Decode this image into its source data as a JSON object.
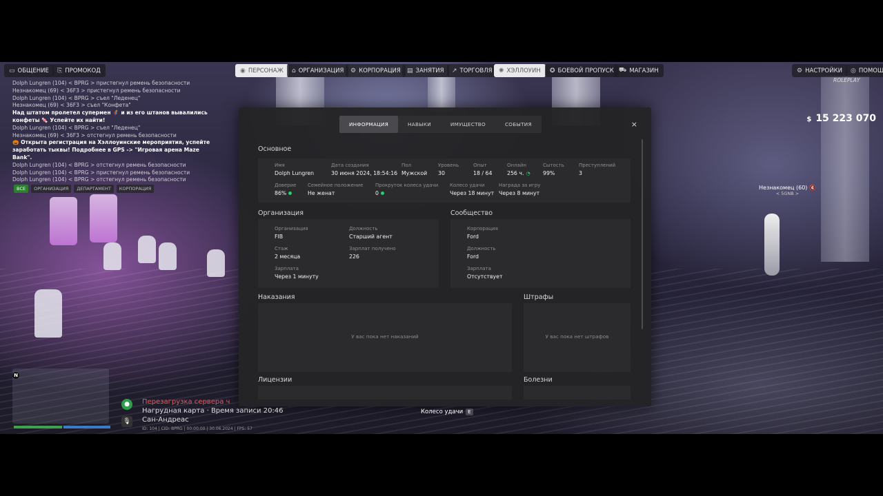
{
  "nav_left": [
    {
      "label": "ОБЩЕНИЕ",
      "icon": "chat-icon"
    },
    {
      "label": "ПРОМОКОД",
      "icon": "ticket-icon"
    }
  ],
  "nav_center": [
    {
      "label": "ПЕРСОНАЖ",
      "icon": "user-icon",
      "active": true
    },
    {
      "label": "ОРГАНИЗАЦИЯ",
      "icon": "organization-icon"
    },
    {
      "label": "КОРПОРАЦИЯ",
      "icon": "corporation-icon"
    },
    {
      "label": "ЗАНЯТИЯ",
      "icon": "jobs-icon"
    },
    {
      "label": "ТОРГОВЛЯ",
      "icon": "trade-icon"
    },
    {
      "label": "ХЭЛЛОУИН",
      "icon": "halloween-icon",
      "active": true
    },
    {
      "label": "БОЕВОЙ ПРОПУСК",
      "icon": "battlepass-icon"
    },
    {
      "label": "МАГАЗИН",
      "icon": "cart-icon"
    }
  ],
  "nav_right": [
    {
      "label": "НАСТРОЙКИ",
      "icon": "gear-icon"
    },
    {
      "label": "ПОМОЩЬ",
      "icon": "help-icon"
    }
  ],
  "chat": {
    "lines": [
      {
        "text": "Dolph Lungren (104) < BPRG > пристегнул ремень безопасности"
      },
      {
        "text": "Незнакомец (69) < 36F3 > пристегнул ремень безопасности"
      },
      {
        "text": "Dolph Lungren (104) < BPRG > съел \"Леденец\""
      },
      {
        "text": "Незнакомец (69) < 36F3 > съел \"Конфета\""
      },
      {
        "text": "Над штатом пролетел супермен 🦸 и из его штанов вывалились конфеты 🍬 Успейте их найти!",
        "highlight": true
      },
      {
        "text": "Dolph Lungren (104) < BPRG > съел \"Леденец\""
      },
      {
        "text": "Незнакомец (69) < 36F3 > отстегнул ремень безопасности"
      },
      {
        "text": "🎃 Открыта регистрация на Хэллоуинские мероприятия, успейте заработать тыквы! Подробнее в GPS -> \"Игровая арена Maze Bank\".",
        "highlight": true
      },
      {
        "text": "Dolph Lungren (104) < BPRG > отстегнул ремень безопасности"
      },
      {
        "text": "Dolph Lungren (104) < BPRG > пристегнул ремень безопасности"
      },
      {
        "text": "Dolph Lungren (104) < BPRG > отстегнул ремень безопасности"
      }
    ],
    "tabs": [
      {
        "label": "ВСЕ",
        "active": true
      },
      {
        "label": "ОРГАНИЗАЦИЯ"
      },
      {
        "label": "ДЕПАРТАМЕНТ"
      },
      {
        "label": "КОРПОРАЦИЯ"
      }
    ]
  },
  "hud": {
    "currency": "$",
    "money": "15 223 070",
    "top_right_label": "ROLEPLAY",
    "npc_name": "Незнакомец (60)",
    "npc_sub": "< 5GNB >",
    "map_n": "N",
    "location_line1": "Перезагрузка сервера ч",
    "location_line2": "Нагрудная карта · Время записи 20:46",
    "location_line3": "Сан-Андреас",
    "status_line": "ID: 104 | CID: BPRG | 00:00:00 | 30.06.2024 | FPS: 57",
    "wheel_hint": "Колесо удачи",
    "wheel_key": "E"
  },
  "modal": {
    "tabs": [
      {
        "label": "ИНФОРМАЦИЯ",
        "active": true
      },
      {
        "label": "НАВЫКИ"
      },
      {
        "label": "ИМУЩЕСТВО"
      },
      {
        "label": "СОБЫТИЯ"
      }
    ],
    "close": "×",
    "basic": {
      "title": "Основное",
      "row1": [
        {
          "label": "Имя",
          "value": "Dolph Lungren"
        },
        {
          "label": "Дата создания",
          "value": "30 июня 2024, 18:54:16"
        },
        {
          "label": "Пол",
          "value": "Мужской"
        },
        {
          "label": "Уровень",
          "value": "30"
        },
        {
          "label": "Опыт",
          "value": "18 / 64"
        },
        {
          "label": "Онлайн",
          "value": "256 ч."
        },
        {
          "label": "Сытость",
          "value": "99%"
        },
        {
          "label": "Преступлений",
          "value": "3"
        }
      ],
      "row2": [
        {
          "label": "Доверие",
          "value": "86%"
        },
        {
          "label": "Семейное положение",
          "value": "Не женат"
        },
        {
          "label": "Прокруток колеса удачи",
          "value": "0"
        },
        {
          "label": "Колесо удачи",
          "value": "Через 18 минут"
        },
        {
          "label": "Награда за игру",
          "value": "Через 8 минут"
        }
      ]
    },
    "organization": {
      "title": "Организация",
      "fields": [
        {
          "label": "Организация",
          "value": "FIB"
        },
        {
          "label": "Должность",
          "value": "Старший агент"
        },
        {
          "label": "Стаж",
          "value": "2 месяца"
        },
        {
          "label": "Зарплат получено",
          "value": "226"
        },
        {
          "label": "Зарплата",
          "value": "Через 1 минуту"
        }
      ]
    },
    "community": {
      "title": "Сообщество",
      "fields": [
        {
          "label": "Корпорация",
          "value": "Ford"
        },
        {
          "label": "Должность",
          "value": "Ford"
        },
        {
          "label": "Зарплата",
          "value": "Отсутствует"
        }
      ]
    },
    "punishments": {
      "title": "Наказания",
      "empty": "У вас пока нет наказаний"
    },
    "fines": {
      "title": "Штрафы",
      "empty": "У вас пока нет штрафов"
    },
    "licenses": {
      "title": "Лицензии"
    },
    "diseases": {
      "title": "Болезни"
    }
  }
}
